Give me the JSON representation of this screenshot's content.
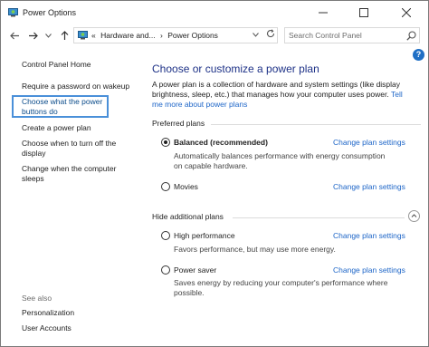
{
  "window": {
    "title": "Power Options"
  },
  "address_bar": {
    "prefix": "«",
    "breadcrumb": [
      "Hardware and...",
      "Power Options"
    ],
    "separator": "›"
  },
  "search": {
    "placeholder": "Search Control Panel"
  },
  "sidebar": {
    "home": "Control Panel Home",
    "links": [
      {
        "label": "Require a password on wakeup"
      },
      {
        "label": "Choose what the power buttons do",
        "line1": "Choose what the power",
        "line2": "buttons do"
      },
      {
        "label": "Create a power plan"
      },
      {
        "label": "Choose when to turn off the display",
        "line1": "Choose when to turn off the",
        "line2": "display"
      },
      {
        "label": "Change when the computer sleeps",
        "line1": "Change when the computer",
        "line2": "sleeps"
      }
    ],
    "see_also": "See also",
    "see_also_links": [
      "Personalization",
      "User Accounts"
    ]
  },
  "main": {
    "heading": "Choose or customize a power plan",
    "description_line1": "A power plan is a collection of hardware and system settings (like display",
    "description_line2_a": "brightness, sleep, etc.) that manages how your computer uses power. ",
    "description_line2_link": "Tell",
    "description_line3_link": "me more about power plans",
    "preferred_label": "Preferred plans",
    "hidden_label": "Hide additional plans",
    "change_label": "Change plan settings",
    "plans": [
      {
        "name": "Balanced (recommended)",
        "selected": true,
        "desc1": "Automatically balances performance with energy consumption",
        "desc2": "on capable hardware."
      },
      {
        "name": "Movies",
        "selected": false
      },
      {
        "name": "High performance",
        "selected": false,
        "desc1": "Favors performance, but may use more energy."
      },
      {
        "name": "Power saver",
        "selected": false,
        "desc1": "Saves energy by reducing your computer's performance where",
        "desc2": "possible."
      }
    ]
  },
  "colors": {
    "heading": "#1e3287",
    "link": "#1e66c8",
    "highlight": "#4a90d9",
    "help": "#1f6fc5"
  },
  "icons": [
    "power-options-icon",
    "minimize-icon",
    "maximize-icon",
    "close-icon",
    "back-icon",
    "forward-icon",
    "recent-dropdown-icon",
    "up-icon",
    "refresh-icon",
    "search-icon",
    "help-icon",
    "collapse-icon"
  ]
}
